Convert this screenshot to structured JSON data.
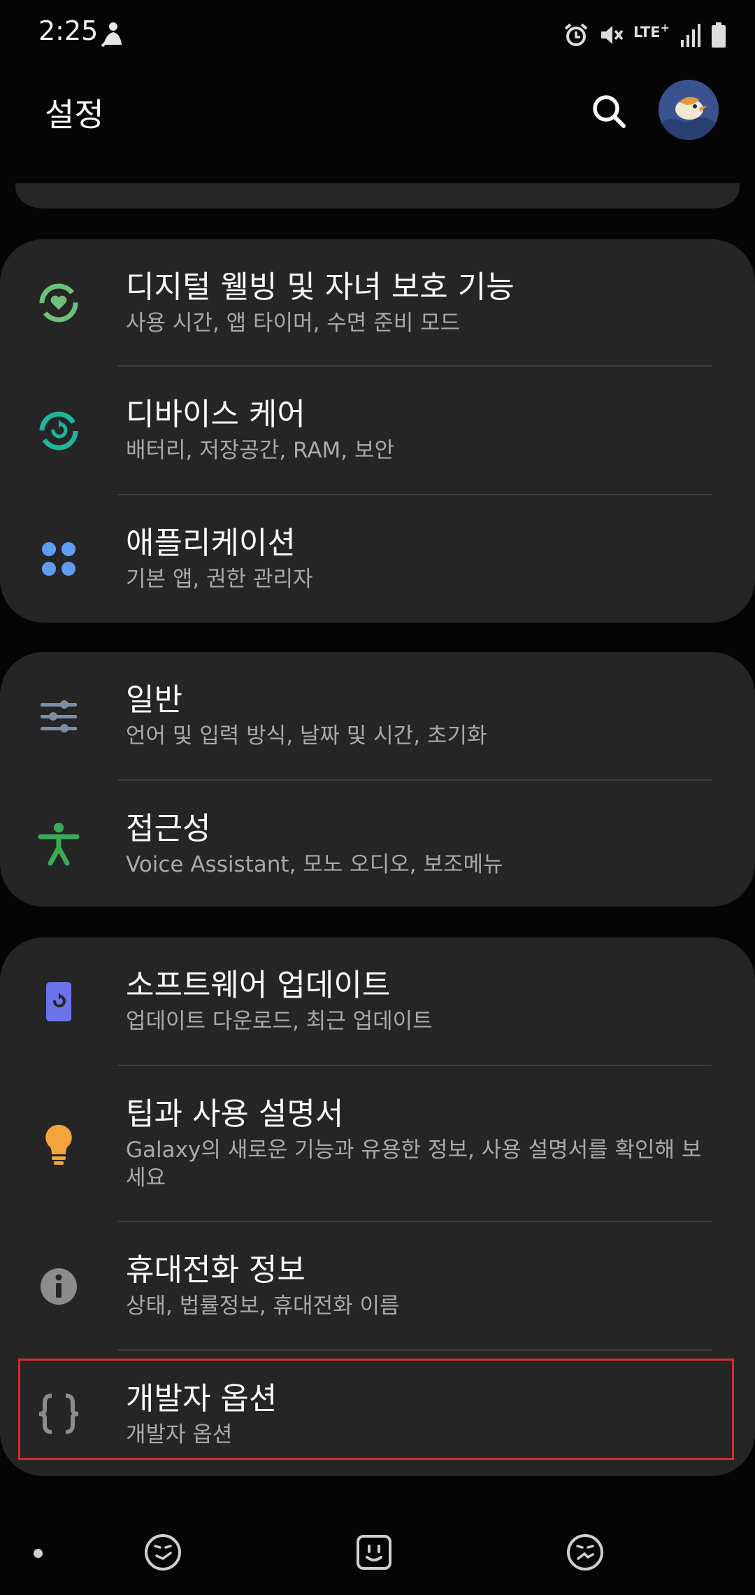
{
  "status_bar": {
    "time": "2:25",
    "network": "LTE",
    "network_plus": "+",
    "icons": [
      "notification-app-icon",
      "alarm-icon",
      "mute-icon",
      "lte-icon",
      "signal-icon",
      "battery-icon"
    ]
  },
  "header": {
    "title": "설정",
    "search_icon": "search-icon",
    "avatar_icon": "profile-avatar"
  },
  "cards": [
    {
      "items": [
        {
          "title": "디지털 웰빙 및 자녀 보호 기능",
          "subtitle": "사용 시간, 앱 타이머, 수면 준비 모드",
          "icon": "digital-wellbeing-icon",
          "color": "#6cc07a"
        },
        {
          "title": "디바이스 케어",
          "subtitle": "배터리, 저장공간, RAM, 보안",
          "icon": "device-care-icon",
          "color": "#20b59a"
        },
        {
          "title": "애플리케이션",
          "subtitle": "기본 앱, 권한 관리자",
          "icon": "apps-icon",
          "color": "#5f9df3"
        }
      ]
    },
    {
      "items": [
        {
          "title": "일반",
          "subtitle": "언어 및 입력 방식, 날짜 및 시간, 초기화",
          "icon": "general-management-icon",
          "color": "#7a8fa6"
        },
        {
          "title": "접근성",
          "subtitle": "Voice Assistant, 모노 오디오, 보조메뉴",
          "icon": "accessibility-icon",
          "color": "#3bab57"
        }
      ]
    },
    {
      "items": [
        {
          "title": "소프트웨어 업데이트",
          "subtitle": "업데이트 다운로드, 최근 업데이트",
          "icon": "software-update-icon",
          "color": "#6a73e8"
        },
        {
          "title": "팁과 사용 설명서",
          "subtitle": "Galaxy의 새로운 기능과 유용한 정보, 사용 설명서를 확인해 보세요",
          "icon": "tips-bulb-icon",
          "color": "#f3a43a"
        },
        {
          "title": "휴대전화 정보",
          "subtitle": "상태, 법률정보, 휴대전화 이름",
          "icon": "info-icon",
          "color": "#8c8c8c"
        },
        {
          "title": "개발자 옵션",
          "subtitle": "개발자 옵션",
          "icon": "developer-options-icon",
          "color": "#8c8c8c"
        }
      ]
    }
  ],
  "nav": {
    "items": [
      "nav-dot",
      "nav-left-icon",
      "nav-home-icon",
      "nav-right-icon"
    ]
  },
  "colors": {
    "background": "#050505",
    "card": "#252525",
    "highlight": "#d12a2d"
  }
}
